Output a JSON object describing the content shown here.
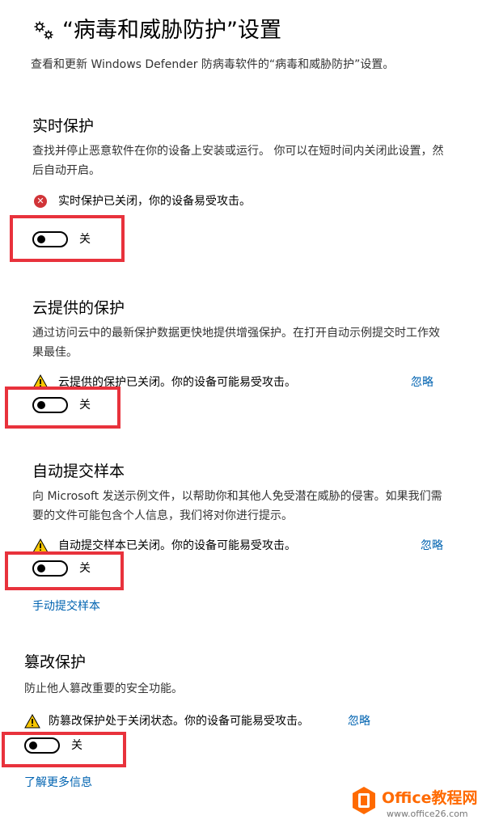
{
  "header": {
    "title": "“病毒和威胁防护”设置",
    "description": "查看和更新 Windows Defender 防病毒软件的“病毒和威胁防护”设置。",
    "icon": "gear-icon"
  },
  "sections": [
    {
      "title": "实时保护",
      "description": "查找并停止恶意软件在你的设备上安装或运行。 你可以在短时间内关闭此设置，然后自动开启。",
      "status": "实时保护已关闭，你的设备易受攻击。",
      "status_icon": "error-icon",
      "toggle_label": "关",
      "toggle_on": false
    },
    {
      "title": "云提供的保护",
      "description": "通过访问云中的最新保护数据更快地提供增强保护。在打开自动示例提交时工作效果最佳。",
      "status": "云提供的保护已关闭。你的设备可能易受攻击。",
      "status_icon": "warning-icon",
      "ignore_label": "忽略",
      "toggle_label": "关",
      "toggle_on": false
    },
    {
      "title": "自动提交样本",
      "description": "向 Microsoft 发送示例文件，以帮助你和其他人免受潜在威胁的侵害。如果我们需要的文件可能包含个人信息，我们将对你进行提示。",
      "status": "自动提交样本已关闭。你的设备可能易受攻击。",
      "status_icon": "warning-icon",
      "ignore_label": "忽略",
      "toggle_label": "关",
      "toggle_on": false,
      "link": "手动提交样本"
    },
    {
      "title": "篡改保护",
      "description": "防止他人篡改重要的安全功能。",
      "status": "防篡改保护处于关闭状态。你的设备可能易受攻击。",
      "status_icon": "warning-icon",
      "ignore_label": "忽略",
      "toggle_label": "关",
      "toggle_on": false,
      "link": "了解更多信息"
    }
  ],
  "colors": {
    "link": "#0063b1",
    "error": "#d13438",
    "warning": "#f7c600",
    "highlight": "#e8323c",
    "watermark": "#ff6a00"
  },
  "watermark": {
    "title": "Office教程网",
    "url": "www.office26.com"
  }
}
